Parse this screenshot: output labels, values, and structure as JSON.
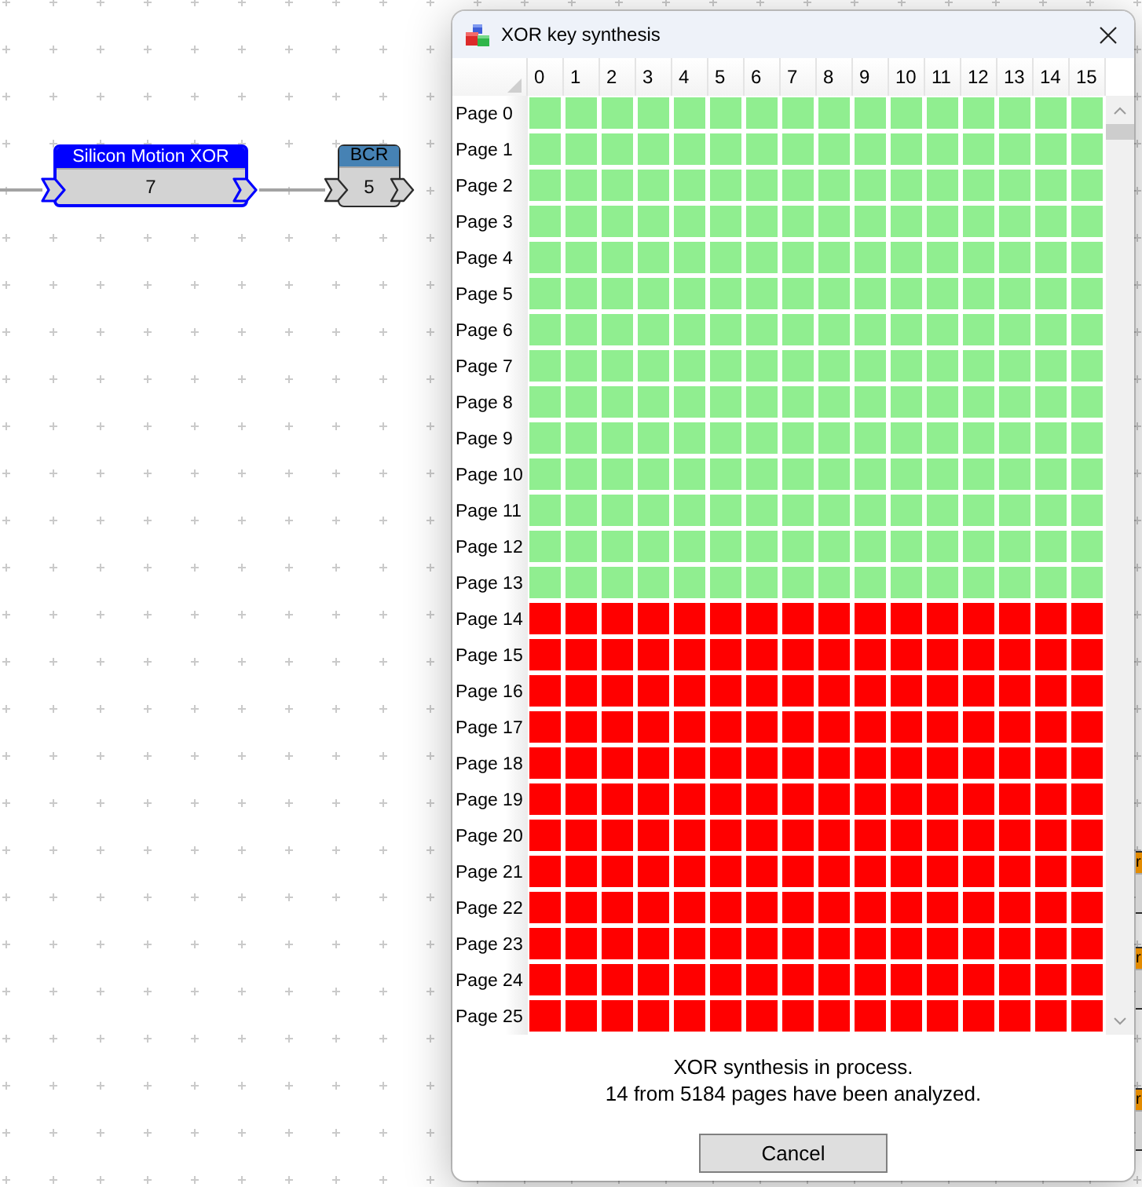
{
  "canvas": {
    "nodes": [
      {
        "title": "Silicon Motion XOR",
        "value": "7",
        "color": "#0000ff",
        "selected": true
      },
      {
        "title": "BCR",
        "value": "5",
        "color": "#4682b4",
        "selected": false
      },
      {
        "title": "r",
        "color": "#e38b00",
        "selected": false
      },
      {
        "title": "r",
        "color": "#e38b00",
        "selected": false
      },
      {
        "title": "r",
        "color": "#e38b00",
        "selected": false
      }
    ]
  },
  "dialog": {
    "title": "XOR key synthesis",
    "grid": {
      "columns": [
        "0",
        "1",
        "2",
        "3",
        "4",
        "5",
        "6",
        "7",
        "8",
        "9",
        "10",
        "11",
        "12",
        "13",
        "14",
        "15"
      ],
      "rows": [
        {
          "label": "Page 0",
          "cells": [
            {
              "analyzed": true
            },
            {
              "analyzed": true
            },
            {
              "analyzed": true
            },
            {
              "analyzed": true
            },
            {
              "analyzed": true
            },
            {
              "analyzed": true
            },
            {
              "analyzed": true
            },
            {
              "analyzed": true
            },
            {
              "analyzed": true
            },
            {
              "analyzed": true
            },
            {
              "analyzed": true
            },
            {
              "analyzed": true
            },
            {
              "analyzed": true
            },
            {
              "analyzed": true
            },
            {
              "analyzed": true
            },
            {
              "analyzed": true
            }
          ]
        },
        {
          "label": "Page 1",
          "cells": [
            {
              "analyzed": true
            },
            {
              "analyzed": true
            },
            {
              "analyzed": true
            },
            {
              "analyzed": true
            },
            {
              "analyzed": true
            },
            {
              "analyzed": true
            },
            {
              "analyzed": true
            },
            {
              "analyzed": true
            },
            {
              "analyzed": true
            },
            {
              "analyzed": true
            },
            {
              "analyzed": true
            },
            {
              "analyzed": true
            },
            {
              "analyzed": true
            },
            {
              "analyzed": true
            },
            {
              "analyzed": true
            },
            {
              "analyzed": true
            }
          ]
        },
        {
          "label": "Page 2",
          "cells": [
            {
              "analyzed": true
            },
            {
              "analyzed": true
            },
            {
              "analyzed": true
            },
            {
              "analyzed": true
            },
            {
              "analyzed": true
            },
            {
              "analyzed": true
            },
            {
              "analyzed": true
            },
            {
              "analyzed": true
            },
            {
              "analyzed": true
            },
            {
              "analyzed": true
            },
            {
              "analyzed": true
            },
            {
              "analyzed": true
            },
            {
              "analyzed": true
            },
            {
              "analyzed": true
            },
            {
              "analyzed": true
            },
            {
              "analyzed": true
            }
          ]
        },
        {
          "label": "Page 3",
          "cells": [
            {
              "analyzed": true
            },
            {
              "analyzed": true
            },
            {
              "analyzed": true
            },
            {
              "analyzed": true
            },
            {
              "analyzed": true
            },
            {
              "analyzed": true
            },
            {
              "analyzed": true
            },
            {
              "analyzed": true
            },
            {
              "analyzed": true
            },
            {
              "analyzed": true
            },
            {
              "analyzed": true
            },
            {
              "analyzed": true
            },
            {
              "analyzed": true
            },
            {
              "analyzed": true
            },
            {
              "analyzed": true
            },
            {
              "analyzed": true
            }
          ]
        },
        {
          "label": "Page 4",
          "cells": [
            {
              "analyzed": true
            },
            {
              "analyzed": true
            },
            {
              "analyzed": true
            },
            {
              "analyzed": true
            },
            {
              "analyzed": true
            },
            {
              "analyzed": true
            },
            {
              "analyzed": true
            },
            {
              "analyzed": true
            },
            {
              "analyzed": true
            },
            {
              "analyzed": true
            },
            {
              "analyzed": true
            },
            {
              "analyzed": true
            },
            {
              "analyzed": true
            },
            {
              "analyzed": true
            },
            {
              "analyzed": true
            },
            {
              "analyzed": true
            }
          ]
        },
        {
          "label": "Page 5",
          "cells": [
            {
              "analyzed": true
            },
            {
              "analyzed": true
            },
            {
              "analyzed": true
            },
            {
              "analyzed": true
            },
            {
              "analyzed": true
            },
            {
              "analyzed": true
            },
            {
              "analyzed": true
            },
            {
              "analyzed": true
            },
            {
              "analyzed": true
            },
            {
              "analyzed": true
            },
            {
              "analyzed": true
            },
            {
              "analyzed": true
            },
            {
              "analyzed": true
            },
            {
              "analyzed": true
            },
            {
              "analyzed": true
            },
            {
              "analyzed": true
            }
          ]
        },
        {
          "label": "Page 6",
          "cells": [
            {
              "analyzed": true
            },
            {
              "analyzed": true
            },
            {
              "analyzed": true
            },
            {
              "analyzed": true
            },
            {
              "analyzed": true
            },
            {
              "analyzed": true
            },
            {
              "analyzed": true
            },
            {
              "analyzed": true
            },
            {
              "analyzed": true
            },
            {
              "analyzed": true
            },
            {
              "analyzed": true
            },
            {
              "analyzed": true
            },
            {
              "analyzed": true
            },
            {
              "analyzed": true
            },
            {
              "analyzed": true
            },
            {
              "analyzed": true
            }
          ]
        },
        {
          "label": "Page 7",
          "cells": [
            {
              "analyzed": true
            },
            {
              "analyzed": true
            },
            {
              "analyzed": true
            },
            {
              "analyzed": true
            },
            {
              "analyzed": true
            },
            {
              "analyzed": true
            },
            {
              "analyzed": true
            },
            {
              "analyzed": true
            },
            {
              "analyzed": true
            },
            {
              "analyzed": true
            },
            {
              "analyzed": true
            },
            {
              "analyzed": true
            },
            {
              "analyzed": true
            },
            {
              "analyzed": true
            },
            {
              "analyzed": true
            },
            {
              "analyzed": true
            }
          ]
        },
        {
          "label": "Page 8",
          "cells": [
            {
              "analyzed": true
            },
            {
              "analyzed": true
            },
            {
              "analyzed": true
            },
            {
              "analyzed": true
            },
            {
              "analyzed": true
            },
            {
              "analyzed": true
            },
            {
              "analyzed": true
            },
            {
              "analyzed": true
            },
            {
              "analyzed": true
            },
            {
              "analyzed": true
            },
            {
              "analyzed": true
            },
            {
              "analyzed": true
            },
            {
              "analyzed": true
            },
            {
              "analyzed": true
            },
            {
              "analyzed": true
            },
            {
              "analyzed": true
            }
          ]
        },
        {
          "label": "Page 9",
          "cells": [
            {
              "analyzed": true
            },
            {
              "analyzed": true
            },
            {
              "analyzed": true
            },
            {
              "analyzed": true
            },
            {
              "analyzed": true
            },
            {
              "analyzed": true
            },
            {
              "analyzed": true
            },
            {
              "analyzed": true
            },
            {
              "analyzed": true
            },
            {
              "analyzed": true
            },
            {
              "analyzed": true
            },
            {
              "analyzed": true
            },
            {
              "analyzed": true
            },
            {
              "analyzed": true
            },
            {
              "analyzed": true
            },
            {
              "analyzed": true
            }
          ]
        },
        {
          "label": "Page 10",
          "cells": [
            {
              "analyzed": true
            },
            {
              "analyzed": true
            },
            {
              "analyzed": true
            },
            {
              "analyzed": true
            },
            {
              "analyzed": true
            },
            {
              "analyzed": true
            },
            {
              "analyzed": true
            },
            {
              "analyzed": true
            },
            {
              "analyzed": true
            },
            {
              "analyzed": true
            },
            {
              "analyzed": true
            },
            {
              "analyzed": true
            },
            {
              "analyzed": true
            },
            {
              "analyzed": true
            },
            {
              "analyzed": true
            },
            {
              "analyzed": true
            }
          ]
        },
        {
          "label": "Page 11",
          "cells": [
            {
              "analyzed": true
            },
            {
              "analyzed": true
            },
            {
              "analyzed": true
            },
            {
              "analyzed": true
            },
            {
              "analyzed": true
            },
            {
              "analyzed": true
            },
            {
              "analyzed": true
            },
            {
              "analyzed": true
            },
            {
              "analyzed": true
            },
            {
              "analyzed": true
            },
            {
              "analyzed": true
            },
            {
              "analyzed": true
            },
            {
              "analyzed": true
            },
            {
              "analyzed": true
            },
            {
              "analyzed": true
            },
            {
              "analyzed": true
            }
          ]
        },
        {
          "label": "Page 12",
          "cells": [
            {
              "analyzed": true
            },
            {
              "analyzed": true
            },
            {
              "analyzed": true
            },
            {
              "analyzed": true
            },
            {
              "analyzed": true
            },
            {
              "analyzed": true
            },
            {
              "analyzed": true
            },
            {
              "analyzed": true
            },
            {
              "analyzed": true
            },
            {
              "analyzed": true
            },
            {
              "analyzed": true
            },
            {
              "analyzed": true
            },
            {
              "analyzed": true
            },
            {
              "analyzed": true
            },
            {
              "analyzed": true
            },
            {
              "analyzed": true
            }
          ]
        },
        {
          "label": "Page 13",
          "cells": [
            {
              "analyzed": true
            },
            {
              "analyzed": true
            },
            {
              "analyzed": true
            },
            {
              "analyzed": true
            },
            {
              "analyzed": true
            },
            {
              "analyzed": true
            },
            {
              "analyzed": true
            },
            {
              "analyzed": true
            },
            {
              "analyzed": true
            },
            {
              "analyzed": true
            },
            {
              "analyzed": true
            },
            {
              "analyzed": true
            },
            {
              "analyzed": true
            },
            {
              "analyzed": true
            },
            {
              "analyzed": true
            },
            {
              "analyzed": true
            }
          ]
        },
        {
          "label": "Page 14",
          "cells": [
            {
              "analyzed": false
            },
            {
              "analyzed": false
            },
            {
              "analyzed": false
            },
            {
              "analyzed": false
            },
            {
              "analyzed": false
            },
            {
              "analyzed": false
            },
            {
              "analyzed": false
            },
            {
              "analyzed": false
            },
            {
              "analyzed": false
            },
            {
              "analyzed": false
            },
            {
              "analyzed": false
            },
            {
              "analyzed": false
            },
            {
              "analyzed": false
            },
            {
              "analyzed": false
            },
            {
              "analyzed": false
            },
            {
              "analyzed": false
            }
          ]
        },
        {
          "label": "Page 15",
          "cells": [
            {
              "analyzed": false
            },
            {
              "analyzed": false
            },
            {
              "analyzed": false
            },
            {
              "analyzed": false
            },
            {
              "analyzed": false
            },
            {
              "analyzed": false
            },
            {
              "analyzed": false
            },
            {
              "analyzed": false
            },
            {
              "analyzed": false
            },
            {
              "analyzed": false
            },
            {
              "analyzed": false
            },
            {
              "analyzed": false
            },
            {
              "analyzed": false
            },
            {
              "analyzed": false
            },
            {
              "analyzed": false
            },
            {
              "analyzed": false
            }
          ]
        },
        {
          "label": "Page 16",
          "cells": [
            {
              "analyzed": false
            },
            {
              "analyzed": false
            },
            {
              "analyzed": false
            },
            {
              "analyzed": false
            },
            {
              "analyzed": false
            },
            {
              "analyzed": false
            },
            {
              "analyzed": false
            },
            {
              "analyzed": false
            },
            {
              "analyzed": false
            },
            {
              "analyzed": false
            },
            {
              "analyzed": false
            },
            {
              "analyzed": false
            },
            {
              "analyzed": false
            },
            {
              "analyzed": false
            },
            {
              "analyzed": false
            },
            {
              "analyzed": false
            }
          ]
        },
        {
          "label": "Page 17",
          "cells": [
            {
              "analyzed": false
            },
            {
              "analyzed": false
            },
            {
              "analyzed": false
            },
            {
              "analyzed": false
            },
            {
              "analyzed": false
            },
            {
              "analyzed": false
            },
            {
              "analyzed": false
            },
            {
              "analyzed": false
            },
            {
              "analyzed": false
            },
            {
              "analyzed": false
            },
            {
              "analyzed": false
            },
            {
              "analyzed": false
            },
            {
              "analyzed": false
            },
            {
              "analyzed": false
            },
            {
              "analyzed": false
            },
            {
              "analyzed": false
            }
          ]
        },
        {
          "label": "Page 18",
          "cells": [
            {
              "analyzed": false
            },
            {
              "analyzed": false
            },
            {
              "analyzed": false
            },
            {
              "analyzed": false
            },
            {
              "analyzed": false
            },
            {
              "analyzed": false
            },
            {
              "analyzed": false
            },
            {
              "analyzed": false
            },
            {
              "analyzed": false
            },
            {
              "analyzed": false
            },
            {
              "analyzed": false
            },
            {
              "analyzed": false
            },
            {
              "analyzed": false
            },
            {
              "analyzed": false
            },
            {
              "analyzed": false
            },
            {
              "analyzed": false
            }
          ]
        },
        {
          "label": "Page 19",
          "cells": [
            {
              "analyzed": false
            },
            {
              "analyzed": false
            },
            {
              "analyzed": false
            },
            {
              "analyzed": false
            },
            {
              "analyzed": false
            },
            {
              "analyzed": false
            },
            {
              "analyzed": false
            },
            {
              "analyzed": false
            },
            {
              "analyzed": false
            },
            {
              "analyzed": false
            },
            {
              "analyzed": false
            },
            {
              "analyzed": false
            },
            {
              "analyzed": false
            },
            {
              "analyzed": false
            },
            {
              "analyzed": false
            },
            {
              "analyzed": false
            }
          ]
        },
        {
          "label": "Page 20",
          "cells": [
            {
              "analyzed": false
            },
            {
              "analyzed": false
            },
            {
              "analyzed": false
            },
            {
              "analyzed": false
            },
            {
              "analyzed": false
            },
            {
              "analyzed": false
            },
            {
              "analyzed": false
            },
            {
              "analyzed": false
            },
            {
              "analyzed": false
            },
            {
              "analyzed": false
            },
            {
              "analyzed": false
            },
            {
              "analyzed": false
            },
            {
              "analyzed": false
            },
            {
              "analyzed": false
            },
            {
              "analyzed": false
            },
            {
              "analyzed": false
            }
          ]
        },
        {
          "label": "Page 21",
          "cells": [
            {
              "analyzed": false
            },
            {
              "analyzed": false
            },
            {
              "analyzed": false
            },
            {
              "analyzed": false
            },
            {
              "analyzed": false
            },
            {
              "analyzed": false
            },
            {
              "analyzed": false
            },
            {
              "analyzed": false
            },
            {
              "analyzed": false
            },
            {
              "analyzed": false
            },
            {
              "analyzed": false
            },
            {
              "analyzed": false
            },
            {
              "analyzed": false
            },
            {
              "analyzed": false
            },
            {
              "analyzed": false
            },
            {
              "analyzed": false
            }
          ]
        },
        {
          "label": "Page 22",
          "cells": [
            {
              "analyzed": false
            },
            {
              "analyzed": false
            },
            {
              "analyzed": false
            },
            {
              "analyzed": false
            },
            {
              "analyzed": false
            },
            {
              "analyzed": false
            },
            {
              "analyzed": false
            },
            {
              "analyzed": false
            },
            {
              "analyzed": false
            },
            {
              "analyzed": false
            },
            {
              "analyzed": false
            },
            {
              "analyzed": false
            },
            {
              "analyzed": false
            },
            {
              "analyzed": false
            },
            {
              "analyzed": false
            },
            {
              "analyzed": false
            }
          ]
        },
        {
          "label": "Page 23",
          "cells": [
            {
              "analyzed": false
            },
            {
              "analyzed": false
            },
            {
              "analyzed": false
            },
            {
              "analyzed": false
            },
            {
              "analyzed": false
            },
            {
              "analyzed": false
            },
            {
              "analyzed": false
            },
            {
              "analyzed": false
            },
            {
              "analyzed": false
            },
            {
              "analyzed": false
            },
            {
              "analyzed": false
            },
            {
              "analyzed": false
            },
            {
              "analyzed": false
            },
            {
              "analyzed": false
            },
            {
              "analyzed": false
            },
            {
              "analyzed": false
            }
          ]
        },
        {
          "label": "Page 24",
          "cells": [
            {
              "analyzed": false
            },
            {
              "analyzed": false
            },
            {
              "analyzed": false
            },
            {
              "analyzed": false
            },
            {
              "analyzed": false
            },
            {
              "analyzed": false
            },
            {
              "analyzed": false
            },
            {
              "analyzed": false
            },
            {
              "analyzed": false
            },
            {
              "analyzed": false
            },
            {
              "analyzed": false
            },
            {
              "analyzed": false
            },
            {
              "analyzed": false
            },
            {
              "analyzed": false
            },
            {
              "analyzed": false
            },
            {
              "analyzed": false
            }
          ]
        },
        {
          "label": "Page 25",
          "cells": [
            {
              "analyzed": false
            },
            {
              "analyzed": false
            },
            {
              "analyzed": false
            },
            {
              "analyzed": false
            },
            {
              "analyzed": false
            },
            {
              "analyzed": false
            },
            {
              "analyzed": false
            },
            {
              "analyzed": false
            },
            {
              "analyzed": false
            },
            {
              "analyzed": false
            },
            {
              "analyzed": false
            },
            {
              "analyzed": false
            },
            {
              "analyzed": false
            },
            {
              "analyzed": false
            },
            {
              "analyzed": false
            },
            {
              "analyzed": false
            }
          ]
        }
      ]
    },
    "message_lines": [
      "XOR synthesis in process.",
      "14 from 5184 pages have been analyzed."
    ],
    "buttons": [
      "Cancel"
    ]
  }
}
